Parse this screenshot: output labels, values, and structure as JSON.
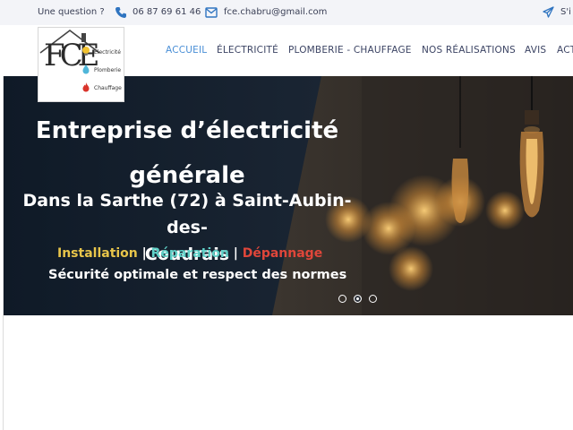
{
  "topbar": {
    "question": "Une question ?",
    "phone": "06 87 69 61 46",
    "email": "fce.chabru@gmail.com",
    "signin_partial": "S'i"
  },
  "logo": {
    "letters": "FCE",
    "items": [
      "Electricité",
      "Plomberie",
      "Chauffage"
    ],
    "colors": [
      "#f2c230",
      "#4fb6d9",
      "#d9342b"
    ]
  },
  "nav": {
    "items": [
      {
        "label": "ACCUEIL",
        "active": true
      },
      {
        "label": "ÉLECTRICITÉ",
        "active": false
      },
      {
        "label": "PLOMBERIE - CHAUFFAGE",
        "active": false
      },
      {
        "label": "NOS RÉALISATIONS",
        "active": false
      },
      {
        "label": "AVIS",
        "active": false
      },
      {
        "label": "ACT",
        "active": false
      }
    ],
    "active_color": "#4a8fd6"
  },
  "hero": {
    "headline_line1": "Entreprise d’électricité",
    "headline_line2": "générale",
    "sub_line1": "Dans la Sarthe (72) à Saint-Aubin-des-",
    "sub_line2": "Coudrais",
    "services": [
      "Installation",
      "Réparation",
      "Dépannage"
    ],
    "separator": " | ",
    "security": "Sécurité optimale et respect des normes",
    "slides_count": 3,
    "active_slide": 2
  },
  "icons": [
    "phone-icon",
    "mail-icon",
    "send-icon",
    "lightbulb-icon",
    "water-drop-icon",
    "flame-icon"
  ]
}
